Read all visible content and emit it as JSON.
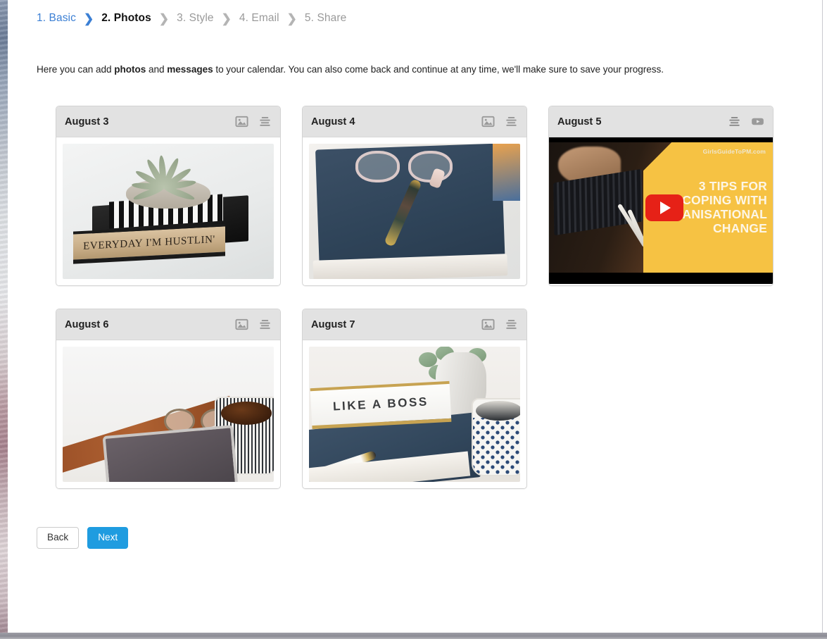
{
  "wizard": {
    "steps": [
      {
        "label": "1. Basic",
        "state": "done"
      },
      {
        "label": "2. Photos",
        "state": "active"
      },
      {
        "label": "3. Style",
        "state": "todo"
      },
      {
        "label": "4. Email",
        "state": "todo"
      },
      {
        "label": "5. Share",
        "state": "todo"
      }
    ],
    "separator": "❯"
  },
  "intro": {
    "part1": "Here you can add ",
    "bold1": "photos",
    "part2": " and ",
    "bold2": "messages",
    "part3": " to your calendar. You can also come back and continue at any time, we'll make sure to save your progress."
  },
  "cards": [
    {
      "title": "August 3",
      "media_type": "photo",
      "icons": [
        "image-icon",
        "lines-icon"
      ],
      "photo_caption": "EVERYDAY I'M HUSTLIN'"
    },
    {
      "title": "August 4",
      "media_type": "photo",
      "icons": [
        "image-icon",
        "lines-icon"
      ],
      "photo_caption": ""
    },
    {
      "title": "August 5",
      "media_type": "video",
      "icons": [
        "lines-icon",
        "youtube-icon"
      ],
      "video": {
        "watermark": "GirlsGuideToPM.com",
        "title_line1": "3 TIPS FOR",
        "title_line2": "COPING WITH",
        "title_line3": "ORGANISATIONAL",
        "title_line4": "CHANGE"
      }
    },
    {
      "title": "August 6",
      "media_type": "photo",
      "icons": [
        "image-icon",
        "lines-icon"
      ],
      "photo_caption": ""
    },
    {
      "title": "August 7",
      "media_type": "photo",
      "icons": [
        "image-icon",
        "lines-icon"
      ],
      "photo_caption": "LIKE A BOSS"
    }
  ],
  "footer": {
    "back_label": "Back",
    "next_label": "Next"
  },
  "colors": {
    "step_done": "#3b7fd4",
    "primary_button": "#1f9ce0",
    "card_header": "#e2e2e2",
    "youtube_red": "#e62117",
    "video_yellow": "#f6c243"
  }
}
